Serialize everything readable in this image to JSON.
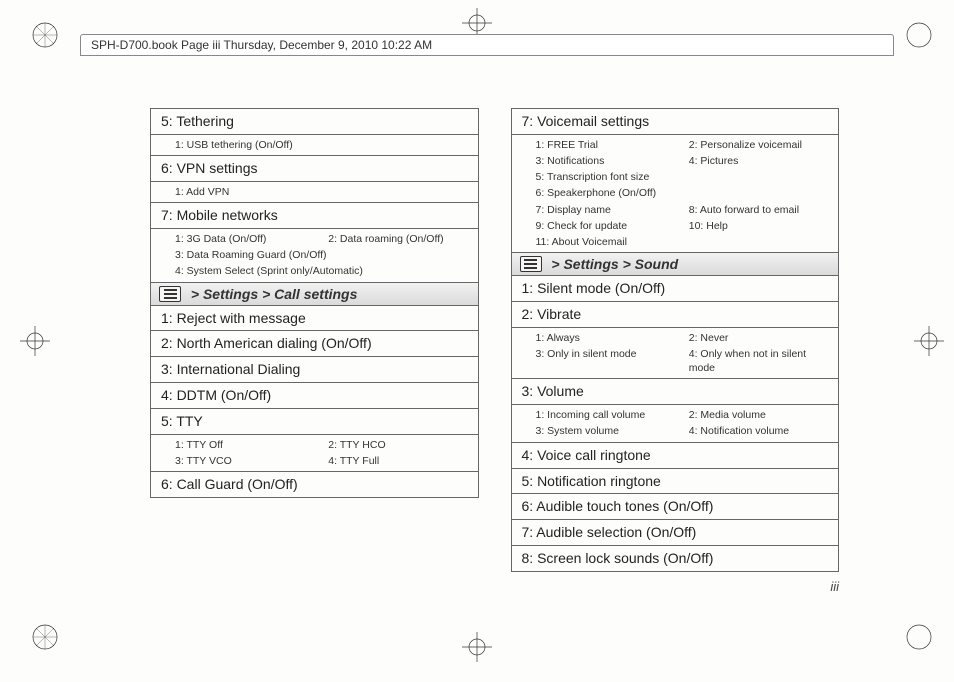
{
  "header": "SPH-D700.book  Page iii  Thursday, December 9, 2010  10:22 AM",
  "page_number": "iii",
  "left": {
    "r1": "5: Tethering",
    "s1a": "1: USB tethering (On/Off)",
    "r2": "6: VPN settings",
    "s2a": "1: Add VPN",
    "r3": "7: Mobile networks",
    "s3a": "1: 3G Data (On/Off)",
    "s3b": "2: Data roaming (On/Off)",
    "s3c": "3: Data Roaming Guard (On/Off)",
    "s3d": "4: System Select (Sprint only/Automatic)",
    "sec1": " > Settings > Call settings",
    "r4": "1: Reject with message",
    "r5": "2: North American dialing (On/Off)",
    "r6": "3: International Dialing",
    "r7": "4: DDTM (On/Off)",
    "r8": "5: TTY",
    "s8a": "1: TTY Off",
    "s8b": "2: TTY HCO",
    "s8c": "3: TTY VCO",
    "s8d": "4: TTY Full",
    "r9": "6: Call Guard (On/Off)"
  },
  "right": {
    "r1": "7: Voicemail settings",
    "s1a": "1: FREE Trial",
    "s1b": "2: Personalize voicemail",
    "s1c": "3: Notifications",
    "s1d": "4: Pictures",
    "s1e": "5: Transcription font size",
    "s1f": "6: Speakerphone (On/Off)",
    "s1g": "7: Display name",
    "s1h": "8: Auto forward to email",
    "s1i": "9: Check for update",
    "s1j": "10: Help",
    "s1k": "11: About Voicemail",
    "sec1": " > Settings > Sound",
    "r2": "1: Silent mode (On/Off)",
    "r3": "2: Vibrate",
    "s3a": "1: Always",
    "s3b": "2: Never",
    "s3c": "3: Only in silent mode",
    "s3d": "4: Only when not in silent mode",
    "r4": "3: Volume",
    "s4a": "1: Incoming call volume",
    "s4b": "2: Media volume",
    "s4c": "3: System volume",
    "s4d": "4: Notification volume",
    "r5": "4: Voice call ringtone",
    "r6": "5: Notification ringtone",
    "r7": "6: Audible touch tones (On/Off)",
    "r8": "7: Audible selection (On/Off)",
    "r9": "8: Screen lock sounds (On/Off)"
  }
}
